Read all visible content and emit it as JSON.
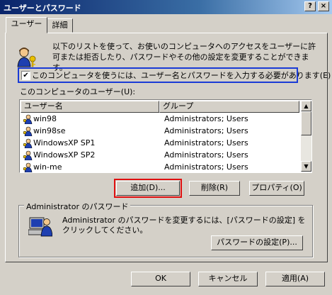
{
  "window": {
    "title": "ユーザーとパスワード",
    "help_label": "?",
    "close_label": "×"
  },
  "tabs": [
    {
      "label": "ユーザー"
    },
    {
      "label": "詳細"
    }
  ],
  "intro_text": "以下のリストを使って、お使いのコンピュータへのアクセスをユーザーに許可または拒否したり、パスワードやその他の設定を変更することができます。",
  "require_login": {
    "checked": true,
    "check_glyph": "✔",
    "label": "このコンピュータを使うには、ユーザー名とパスワードを入力する必要があります(E)"
  },
  "users_list": {
    "label": "このコンピュータのユーザー(U):",
    "columns": [
      "ユーザー名",
      "グループ"
    ],
    "rows": [
      {
        "name": "win98",
        "group": "Administrators; Users"
      },
      {
        "name": "win98se",
        "group": "Administrators; Users"
      },
      {
        "name": "WindowsXP SP1",
        "group": "Administrators; Users"
      },
      {
        "name": "WindowsXP SP2",
        "group": "Administrators; Users"
      },
      {
        "name": "win-me",
        "group": "Administrators; Users"
      }
    ],
    "scroll_up": "▲",
    "scroll_down": "▼"
  },
  "list_buttons": {
    "add": "追加(D)...",
    "remove": "削除(R)",
    "properties": "プロパティ(O)"
  },
  "password_group": {
    "title": "Administrator のパスワード",
    "text": "Administrator のパスワードを変更するには、[パスワードの設定] をクリックしてください。",
    "set_password": "パスワードの設定(P)..."
  },
  "dialog_buttons": {
    "ok": "OK",
    "cancel": "キャンセル",
    "apply": "適用(A)"
  },
  "colors": {
    "title_bar": "#0a246a",
    "highlight_checkbox": "#1a3bd6",
    "highlight_add": "#e01010",
    "dialog_bg": "#d4d0c8"
  }
}
